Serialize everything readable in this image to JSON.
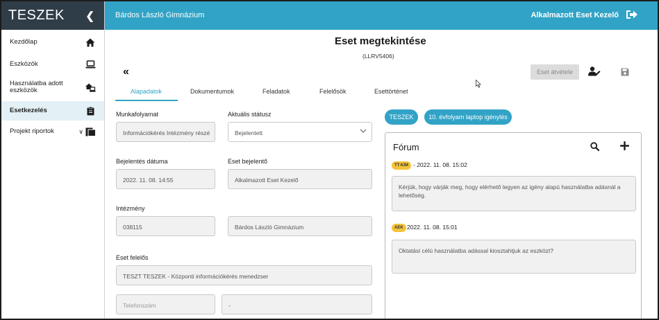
{
  "sidebar": {
    "logo": "TESZEK",
    "collapse_icon": "chevron-left-icon",
    "items": [
      {
        "label": "Kezdőlap",
        "icon": "home-icon"
      },
      {
        "label": "Eszközök",
        "icon": "laptop-icon"
      },
      {
        "label": "Használatba adott eszközök",
        "icon": "home-laptop-icon"
      },
      {
        "label": "Esetkezelés",
        "icon": "clipboard-icon",
        "active": true
      },
      {
        "label": "Projekt riportok",
        "icon": "report-icon",
        "expandable": true
      }
    ]
  },
  "header": {
    "school": "Bárdos László Gimnázium",
    "user": "Alkalmazott Eset Kezelő",
    "logout_icon": "logout-icon",
    "color": "#31a3c6"
  },
  "page": {
    "title": "Eset megtekintése",
    "case_id": "(LLRV5406)",
    "take_button": "Eset átvétele"
  },
  "tabs": [
    "Alapadatok",
    "Dokumentumok",
    "Feladatok",
    "Felelősök",
    "Esettörténet"
  ],
  "form": {
    "workflow_label": "Munkafolyamat",
    "workflow_value": "Információkérés Intézmény részé",
    "status_label": "Aktuális státusz",
    "status_value": "Bejelentett",
    "report_date_label": "Bejelentés dátuma",
    "report_date_value": "2022. 11. 08. 14:55",
    "reporter_label": "Eset bejelentő",
    "reporter_value": "Alkalmazott Eset Kezelő",
    "institution_label": "Intézmény",
    "institution_code": "038115",
    "institution_name": "Bárdos László Gimnázium",
    "owner_label": "Eset felelős",
    "owner_value": "TESZT TESZEK - Központi információkérés menedzser",
    "phone_placeholder": "Telefonszám",
    "phone_extra": "-"
  },
  "chips": [
    "TESZEK",
    "10. évfolyam laptop igénylés"
  ],
  "forum": {
    "title": "Fórum",
    "messages": [
      {
        "badge": "TT-KIM",
        "date": "- 2022. 11. 08. 15:02",
        "text": "Kérjük, hogy várják meg, hogy elérhető legyen az igény alapú használatba adásnál a lehetőség."
      },
      {
        "badge": "AEK",
        "date": "2022. 11. 08. 15:01",
        "text": "Oktatási célú használatba adással kiosztahtjuk az eszközt?"
      }
    ]
  }
}
